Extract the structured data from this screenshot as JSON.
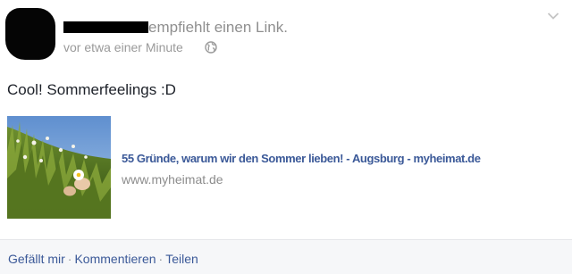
{
  "post": {
    "recommends_text": "empfiehlt einen Link.",
    "timestamp": "vor etwa einer Minute",
    "privacy_icon": "globe-icon",
    "options_icon": "chevron-down-icon",
    "text": "Cool! Sommerfeelings :D"
  },
  "link": {
    "title": "55 Gründe, warum wir den Sommer lieben! - Augsburg - myheimat.de",
    "domain": "www.myheimat.de"
  },
  "actions": {
    "like": "Gefällt mir",
    "comment": "Kommentieren",
    "share": "Teilen",
    "separator": "·"
  },
  "colors": {
    "link": "#3b5998",
    "muted": "#90949c",
    "footer_bg": "#f6f7f9"
  }
}
